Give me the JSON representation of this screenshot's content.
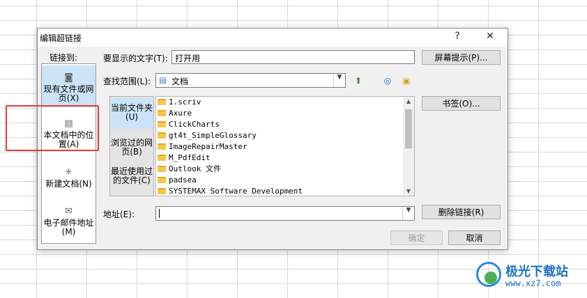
{
  "dialog": {
    "title": "编辑超链接",
    "help": "?",
    "close": "✕"
  },
  "link_to": {
    "label": "链接到:",
    "items": [
      {
        "label": "现有文件或网页(X)",
        "icon": "globe-page-icon"
      },
      {
        "label": "本文档中的位置(A)",
        "icon": "document-place-icon"
      },
      {
        "label": "新建文档(N)",
        "icon": "new-document-icon"
      },
      {
        "label": "电子邮件地址(M)",
        "icon": "email-icon"
      }
    ]
  },
  "display_text": {
    "label": "要显示的文字(T):",
    "value": "打开用"
  },
  "screentip_button": "屏幕提示(P)...",
  "look_in": {
    "label": "查找范围(L):",
    "value": "文档"
  },
  "look_in_tabs": [
    "当前文件夹(U)",
    "浏览过的网页(B)",
    "最近使用过的文件(C)"
  ],
  "files": [
    "1.scriv",
    "Axure",
    "ClickCharts",
    "gt4t_SimpleGlossary",
    "ImageRepairMaster",
    "M_PdfEdit",
    "Outlook 文件",
    "padsea",
    "SYSTEMAX Software Development"
  ],
  "bookmark_button": "书签(O)...",
  "address": {
    "label": "地址(E):",
    "value": ""
  },
  "remove_link_button": "删除链接(R)",
  "ok_button": "确定",
  "cancel_button": "取消",
  "watermark": {
    "name": "极光下载站",
    "url": "www.xz7.com"
  },
  "colors": {
    "selection": "#cce4f7",
    "highlight_box": "#e53935",
    "folder": "#f5c74a",
    "watermark": "#1e73c4"
  }
}
